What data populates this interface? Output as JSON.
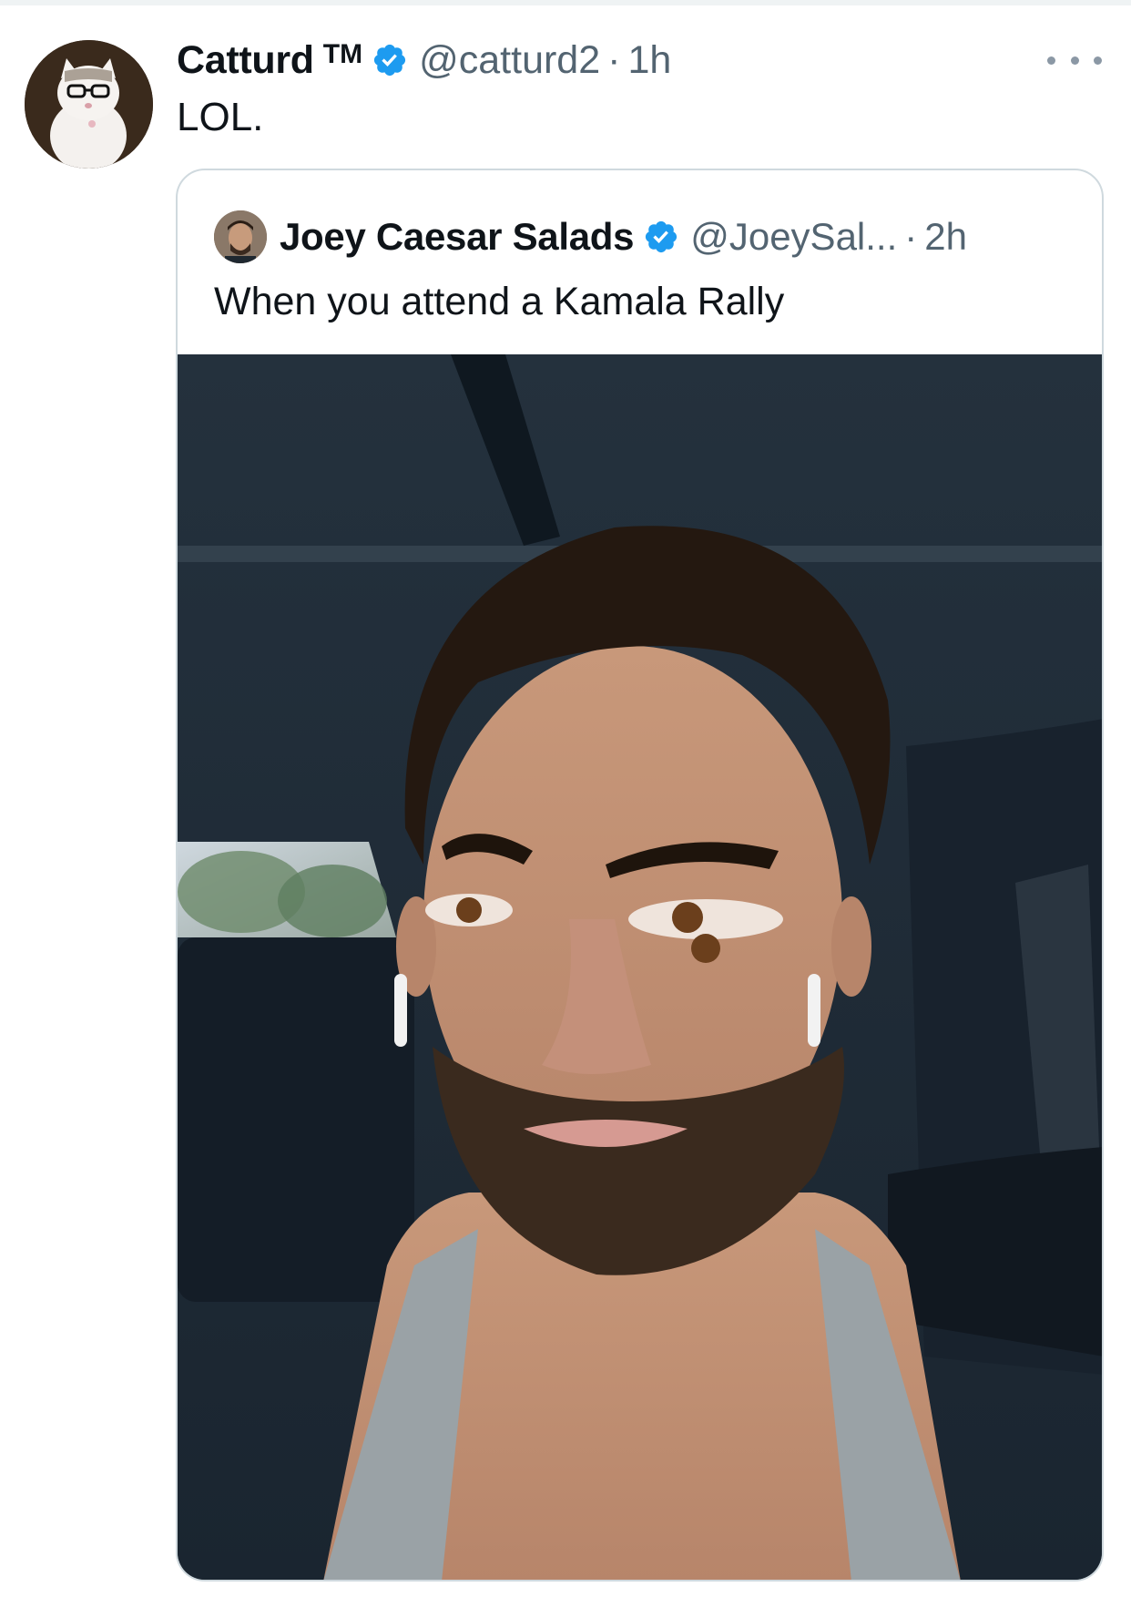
{
  "tweet": {
    "display_name": "Catturd",
    "badge": "TM",
    "verified": true,
    "handle": "@catturd2",
    "separator": "·",
    "time": "1h",
    "text": "LOL.",
    "more_icon": "ellipsis-icon"
  },
  "quoted": {
    "display_name": "Joey Caesar Salads",
    "verified": true,
    "handle": "@JoeySal...",
    "separator": "·",
    "time": "2h",
    "text": "When you attend a Kamala Rally"
  },
  "colors": {
    "verified_blue": "#1d9bf0",
    "secondary_text": "#536471",
    "border": "#cfd9de"
  }
}
